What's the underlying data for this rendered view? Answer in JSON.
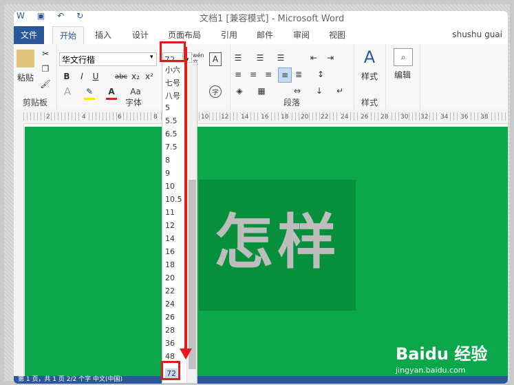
{
  "titlebar": {
    "title": "文档1 [兼容模式] - Microsoft Word"
  },
  "tabs": [
    "文件",
    "开始",
    "插入",
    "设计",
    "页面布局",
    "引用",
    "邮件",
    "审阅",
    "视图"
  ],
  "user": {
    "name": "shushu guai"
  },
  "ribbon": {
    "clipboard": {
      "paste": "粘贴",
      "label": "剪贴板"
    },
    "font": {
      "name": "华文行楷",
      "size": "72",
      "label": "字体",
      "bold": "B",
      "italic": "I",
      "underline": "U",
      "strike": "abc",
      "sub": "x₂",
      "sup": "x²",
      "case": "Aa",
      "wen": "wén 文",
      "framed": "A"
    },
    "paragraph": {
      "label": "段落"
    },
    "styles": {
      "btn": "样式",
      "label": "样式"
    },
    "edit": {
      "btn": "编辑"
    }
  },
  "ruler": {
    "ticks": [
      "2",
      "4",
      "6",
      "8",
      "10",
      "12",
      "14",
      "16",
      "18",
      "20",
      "22",
      "24",
      "26",
      "28",
      "30",
      "32",
      "34",
      "36",
      "38"
    ]
  },
  "document": {
    "text": "怎样"
  },
  "dropdown": {
    "items": [
      "小六",
      "七号",
      "八号",
      "5",
      "5.5",
      "6.5",
      "7.5",
      "8",
      "9",
      "10",
      "10.5",
      "11",
      "12",
      "14",
      "16",
      "18",
      "20",
      "22",
      "24",
      "26",
      "28",
      "36",
      "48",
      "72"
    ],
    "selected": "72"
  },
  "statusbar": {
    "text": "第 1 页，共 1 页   2/2 个字   中文(中国)"
  },
  "watermark": {
    "brand": "Baidu 经验",
    "url": "jingyan.baidu.com"
  },
  "colors": {
    "accent": "#2b579a",
    "document_bg": "#0aa84a",
    "highlight": "#e31b1b"
  }
}
